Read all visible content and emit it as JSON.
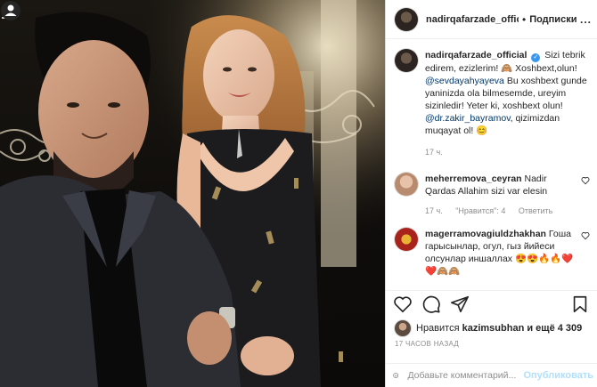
{
  "post": {
    "author": "nadirqafarzade_official",
    "follow_label": "Подписки",
    "separator": "•",
    "more_label": "...",
    "caption": {
      "text1": "Sizi tebrik edirem, ezizlerim! 🙈 Xoshbext,olun!",
      "mention1": "@sevdayahyayeva",
      "text2": "Bu xoshbext gunde yaninizda ola bilmesemde, ureyim sizinledir! Yeter ki, xoshbext olun!",
      "mention2": "@dr.zakir_bayramov",
      "text3": ", qizimizdan muqayat ol! 😊",
      "time": "17 ч."
    },
    "comments": [
      {
        "user": "meherremova_ceyran",
        "text": "Nadir Qardas Allahim sizi var elesin",
        "time": "17 ч.",
        "likes": "\"Нравится\": 4",
        "reply": "Ответить"
      },
      {
        "user": "magerramovagiuldzhakhan",
        "text": "Гоша гарысынлар, огул, гыз йийеси олсунлар иншаллах 😍😍🔥🔥❤️❤️🙈🙈"
      }
    ],
    "likes_prefix": "Нравится",
    "likes_user": "kazimsubhan",
    "likes_suffix": "и ещё 4 309",
    "timestamp": "17 ЧАСОВ НАЗАД",
    "comment_placeholder": "Добавьте комментарий...",
    "publish_label": "Опубликовать"
  },
  "colors": {
    "link": "#00376b",
    "verified": "#3897f0",
    "muted": "#8e8e8e",
    "publish_disabled": "#b2dffc"
  },
  "icons": [
    "download-icon",
    "user-tag-icon",
    "heart-icon",
    "comment-icon",
    "share-icon",
    "bookmark-icon",
    "emoji-icon",
    "verified-icon"
  ]
}
